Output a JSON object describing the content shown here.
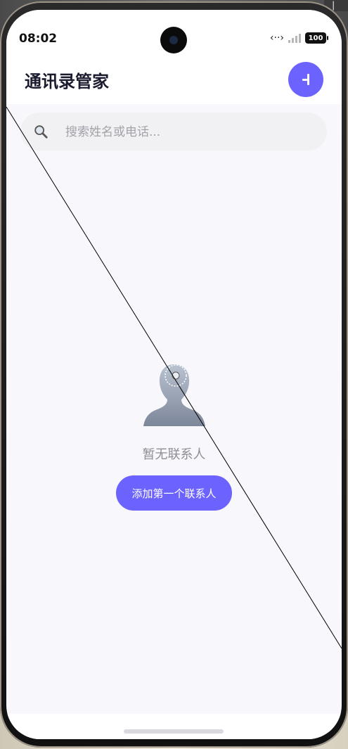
{
  "status_bar": {
    "time": "08:02",
    "icons": [
      "data-sync-icon",
      "signal-icon",
      "battery-icon"
    ],
    "data_glyph": "‹··›",
    "battery": "100"
  },
  "header": {
    "title": "通讯录管家",
    "add_button_icon": "add-contact-icon"
  },
  "search": {
    "placeholder": "搜索姓名或电话...",
    "value": "",
    "icon": "search-icon"
  },
  "empty_state": {
    "icon": "person-silhouette-icon",
    "message": "暂无联系人",
    "button_label": "添加第一个联系人"
  },
  "colors": {
    "accent": "#6c63ff",
    "page_background": "#f8f7fc",
    "title_text": "#1b1b2f",
    "muted_text": "#8e8e96"
  }
}
